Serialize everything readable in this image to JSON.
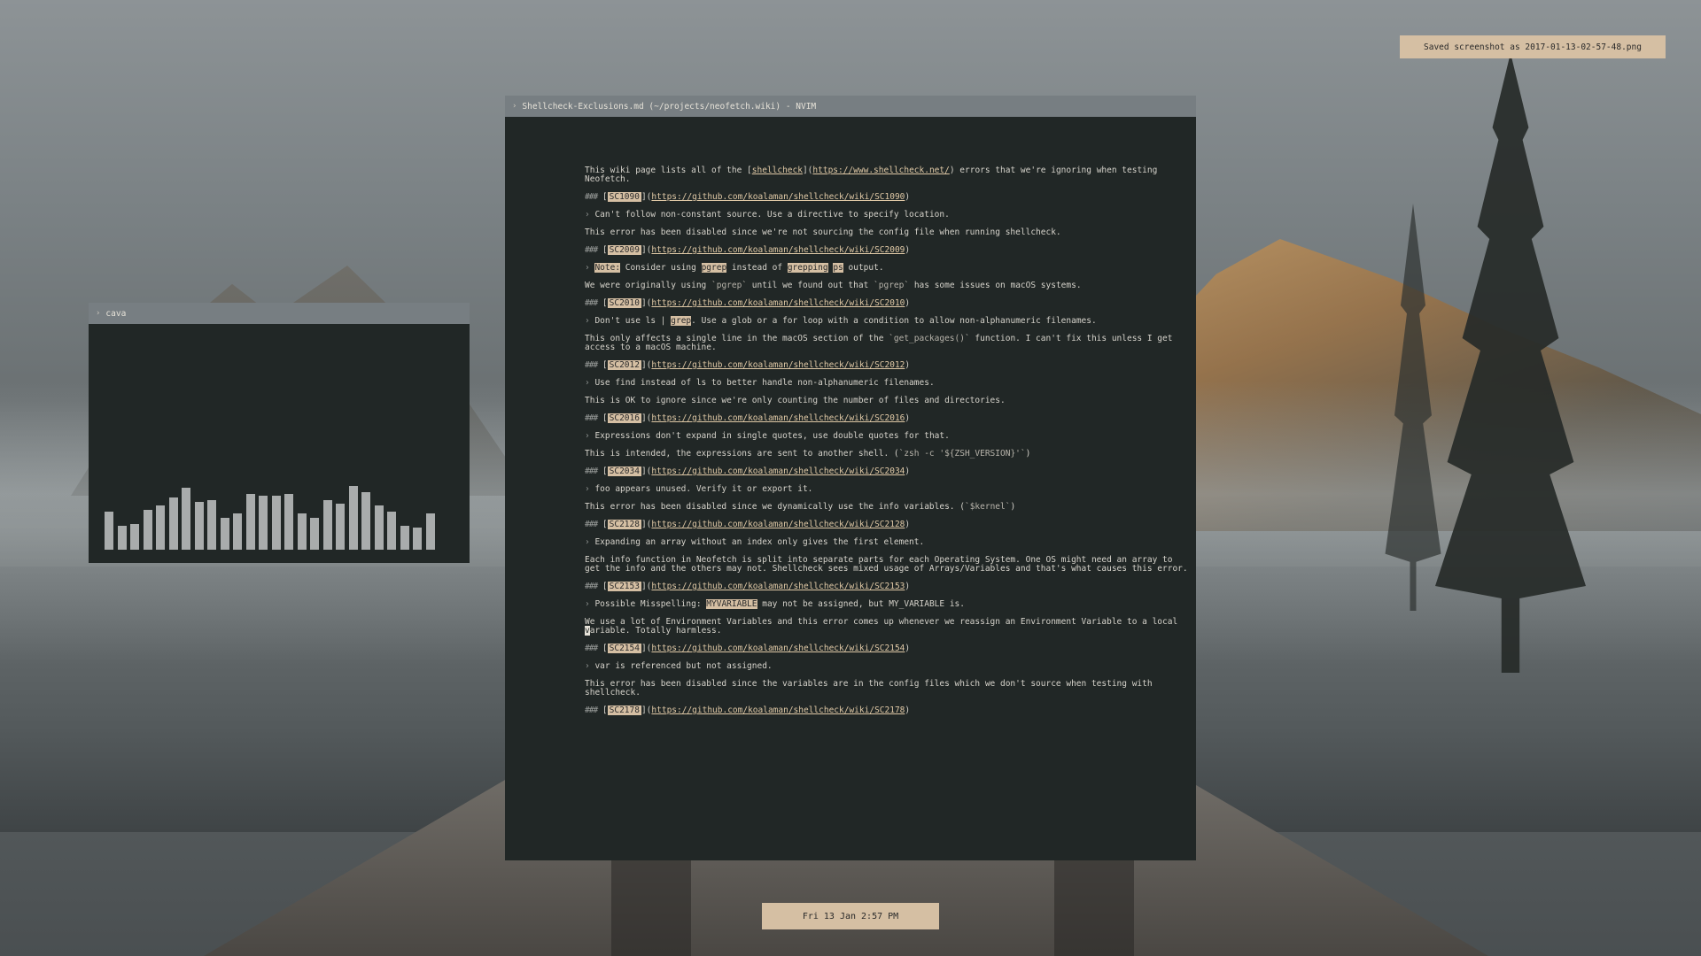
{
  "notification": {
    "text": "Saved screenshot as 2017-01-13-02-57-48.png"
  },
  "clock": {
    "text": "Fri 13 Jan  2:57 PM"
  },
  "cava": {
    "title": "cava",
    "bars": [
      0.48,
      0.3,
      0.32,
      0.5,
      0.55,
      0.65,
      0.78,
      0.6,
      0.62,
      0.4,
      0.45,
      0.7,
      0.68,
      0.68,
      0.7,
      0.45,
      0.4,
      0.62,
      0.58,
      0.8,
      0.72,
      0.55,
      0.48,
      0.3,
      0.28,
      0.45
    ]
  },
  "nvim": {
    "title": "Shellcheck-Exclusions.md (~/projects/neofetch.wiki) - NVIM",
    "intro": {
      "pre": "This wiki page lists all of the [",
      "link1": "shellcheck",
      "mid": "](",
      "link2": "https://www.shellcheck.net/",
      "post": ") errors that we're ignoring when testing",
      "line2": "Neofetch."
    },
    "entries": [
      {
        "code": "SC1090",
        "url": "https://github.com/koalaman/shellcheck/wiki/SC1090",
        "quote": "Can't follow non-constant source. Use a directive to specify location.",
        "text": "This error has been disabled since we're not sourcing the config file when running shellcheck."
      },
      {
        "code": "SC2009",
        "url": "https://github.com/koalaman/shellcheck/wiki/SC2009",
        "quote_parts": [
          "Note:",
          " Consider using ",
          "pgrep",
          " instead of ",
          "grepping",
          " ",
          "ps",
          " output."
        ],
        "text_parts": [
          "We were originally using ",
          "`pgrep`",
          " until we found out that ",
          "`pgrep`",
          " has some issues on macOS systems."
        ]
      },
      {
        "code": "SC2010",
        "url": "https://github.com/koalaman/shellcheck/wiki/SC2010",
        "quote_parts": [
          "Don't use ls | ",
          "grep",
          ". Use a glob or a for loop with a condition to allow non-alphanumeric filenames."
        ],
        "text_parts": [
          "This only affects a single line in the macOS section of the ",
          "`get_packages()`",
          " function. I can't fix this unless I get"
        ],
        "text_line2": "access to a macOS machine."
      },
      {
        "code": "SC2012",
        "url": "https://github.com/koalaman/shellcheck/wiki/SC2012",
        "quote": "Use find instead of ls to better handle non-alphanumeric filenames.",
        "text": "This is OK to ignore since we're only counting the number of files and directories."
      },
      {
        "code": "SC2016",
        "url": "https://github.com/koalaman/shellcheck/wiki/SC2016",
        "quote": "Expressions don't expand in single quotes, use double quotes for that.",
        "text_parts": [
          "This is intended, the expressions are sent to another shell. (",
          "`zsh -c '${ZSH_VERSION}'`",
          ")"
        ]
      },
      {
        "code": "SC2034",
        "url": "https://github.com/koalaman/shellcheck/wiki/SC2034",
        "quote": "foo appears unused. Verify it or export it.",
        "text_parts": [
          "This error has been disabled since we dynamically use the info variables. (",
          "`$kernel`",
          ")"
        ]
      },
      {
        "code": "SC2128",
        "url": "https://github.com/koalaman/shellcheck/wiki/SC2128",
        "quote": "Expanding an array without an index only gives the first element.",
        "text": "Each info function in Neofetch is split into separate parts for each Operating System. One OS might need an array to",
        "text_line2": "get the info and the others may not. Shellcheck sees mixed usage of Arrays/Variables and that's what causes this error."
      },
      {
        "code": "SC2153",
        "url": "https://github.com/koalaman/shellcheck/wiki/SC2153",
        "quote_parts": [
          "Possible Misspelling: ",
          "MYVARIABLE",
          " may not be assigned, but MY_VARIABLE is."
        ],
        "text": "We use a lot of Environment Variables and this error comes up whenever we reassign an Environment Variable to a local",
        "text_line2_cursor": "v",
        "text_line2": "ariable. Totally harmless."
      },
      {
        "code": "SC2154",
        "url": "https://github.com/koalaman/shellcheck/wiki/SC2154",
        "quote": "var is referenced but not assigned.",
        "text": "This error has been disabled since the variables are in the config files which we don't source when testing with",
        "text_line2": "shellcheck."
      },
      {
        "code": "SC2178",
        "url": "https://github.com/koalaman/shellcheck/wiki/SC2178"
      }
    ]
  }
}
